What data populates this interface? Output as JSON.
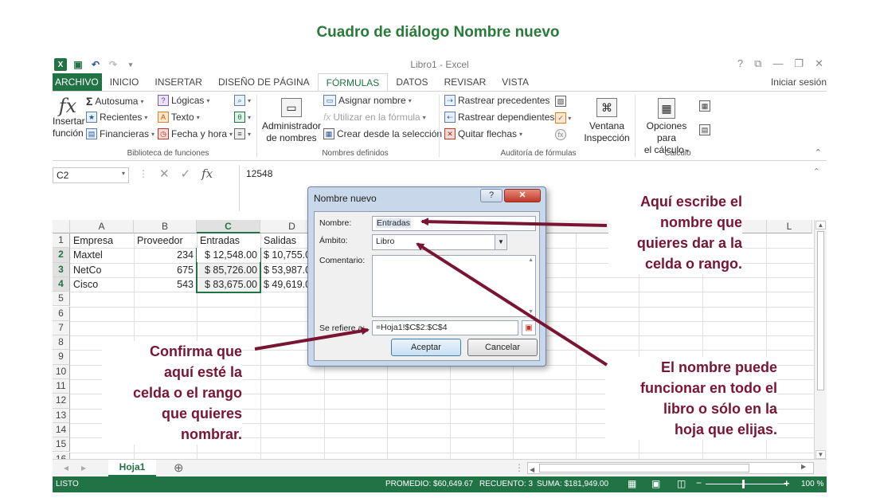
{
  "headline": "Cuadro de diálogo Nombre nuevo",
  "window": {
    "title": "Libro1 - Excel",
    "help": "?",
    "controls": [
      "⧉",
      "—",
      "❐",
      "✕"
    ],
    "signin": "Iniciar sesión"
  },
  "tabs": [
    "ARCHIVO",
    "INICIO",
    "INSERTAR",
    "DISEÑO DE PÁGINA",
    "FÓRMULAS",
    "DATOS",
    "REVISAR",
    "VISTA"
  ],
  "ribbon": {
    "insert_function": [
      "Insertar",
      "función"
    ],
    "library": [
      {
        "label": "Autosuma",
        "icon": "Σ"
      },
      {
        "label": "Recientes",
        "icon": "★"
      },
      {
        "label": "Financieras",
        "icon": "▤"
      },
      {
        "label": "Lógicas",
        "icon": "?"
      },
      {
        "label": "Texto",
        "icon": "A"
      },
      {
        "label": "Fecha y hora",
        "icon": "◷"
      }
    ],
    "library_label": "Biblioteca de funciones",
    "name_manager": [
      "Administrador",
      "de nombres"
    ],
    "names": [
      "Asignar nombre",
      "Utilizar en la fórmula",
      "Crear desde la selección"
    ],
    "names_label": "Nombres definidos",
    "audit": [
      "Rastrear precedentes",
      "Rastrear dependientes",
      "Quitar flechas"
    ],
    "watch": [
      "Ventana",
      "Inspección"
    ],
    "audit_label": "Auditoría de fórmulas",
    "calc_options": [
      "Opciones para",
      "el cálculo"
    ],
    "calc_label": "Cálculo"
  },
  "formula_bar": {
    "cell_ref": "C2",
    "value": "12548"
  },
  "columns": [
    "A",
    "B",
    "C",
    "D",
    "L"
  ],
  "rows": [
    "1",
    "2",
    "3",
    "4",
    "5",
    "6",
    "7",
    "8",
    "9",
    "10",
    "11",
    "12",
    "13",
    "14",
    "15",
    "16"
  ],
  "table": {
    "headers": [
      "Empresa",
      "Proveedor",
      "Entradas",
      "Salidas"
    ],
    "rows": [
      [
        "Maxtel",
        "234",
        "$ 12,548.00",
        "$ 10,755.0"
      ],
      [
        "NetCo",
        "675",
        "$ 85,726.00",
        "$ 53,987.0"
      ],
      [
        "Cisco",
        "543",
        "$ 83,675.00",
        "$ 49,619.0"
      ]
    ]
  },
  "sheet_tab": "Hoja1",
  "status": {
    "mode": "LISTO",
    "average": "PROMEDIO:  $60,649.67",
    "count": "RECUENTO: 3",
    "sum": "SUMA:  $181,949.00",
    "zoom": "100 %"
  },
  "dialog": {
    "title": "Nombre nuevo",
    "name_label": "Nombre:",
    "name_value": "Entradas",
    "scope_label": "Ámbito:",
    "scope_value": "Libro",
    "comment_label": "Comentario:",
    "refers_label": "Se refiere a:",
    "refers_value": "=Hoja1!$C$2:$C$4",
    "ok": "Aceptar",
    "cancel": "Cancelar"
  },
  "callouts": {
    "name": [
      "Aquí escribe el",
      "nombre que",
      "quieres dar a la",
      "celda o rango."
    ],
    "confirm": [
      "Confirma que",
      "aquí esté la",
      "celda o el rango",
      "que quieres",
      "nombrar."
    ],
    "scope": [
      "El nombre puede",
      "funcionar en todo el",
      "libro o sólo en la",
      "hoja que elijas."
    ]
  },
  "colors": {
    "excel_green": "#217346",
    "callout": "#7a1433",
    "headline": "#2a7a3a"
  }
}
